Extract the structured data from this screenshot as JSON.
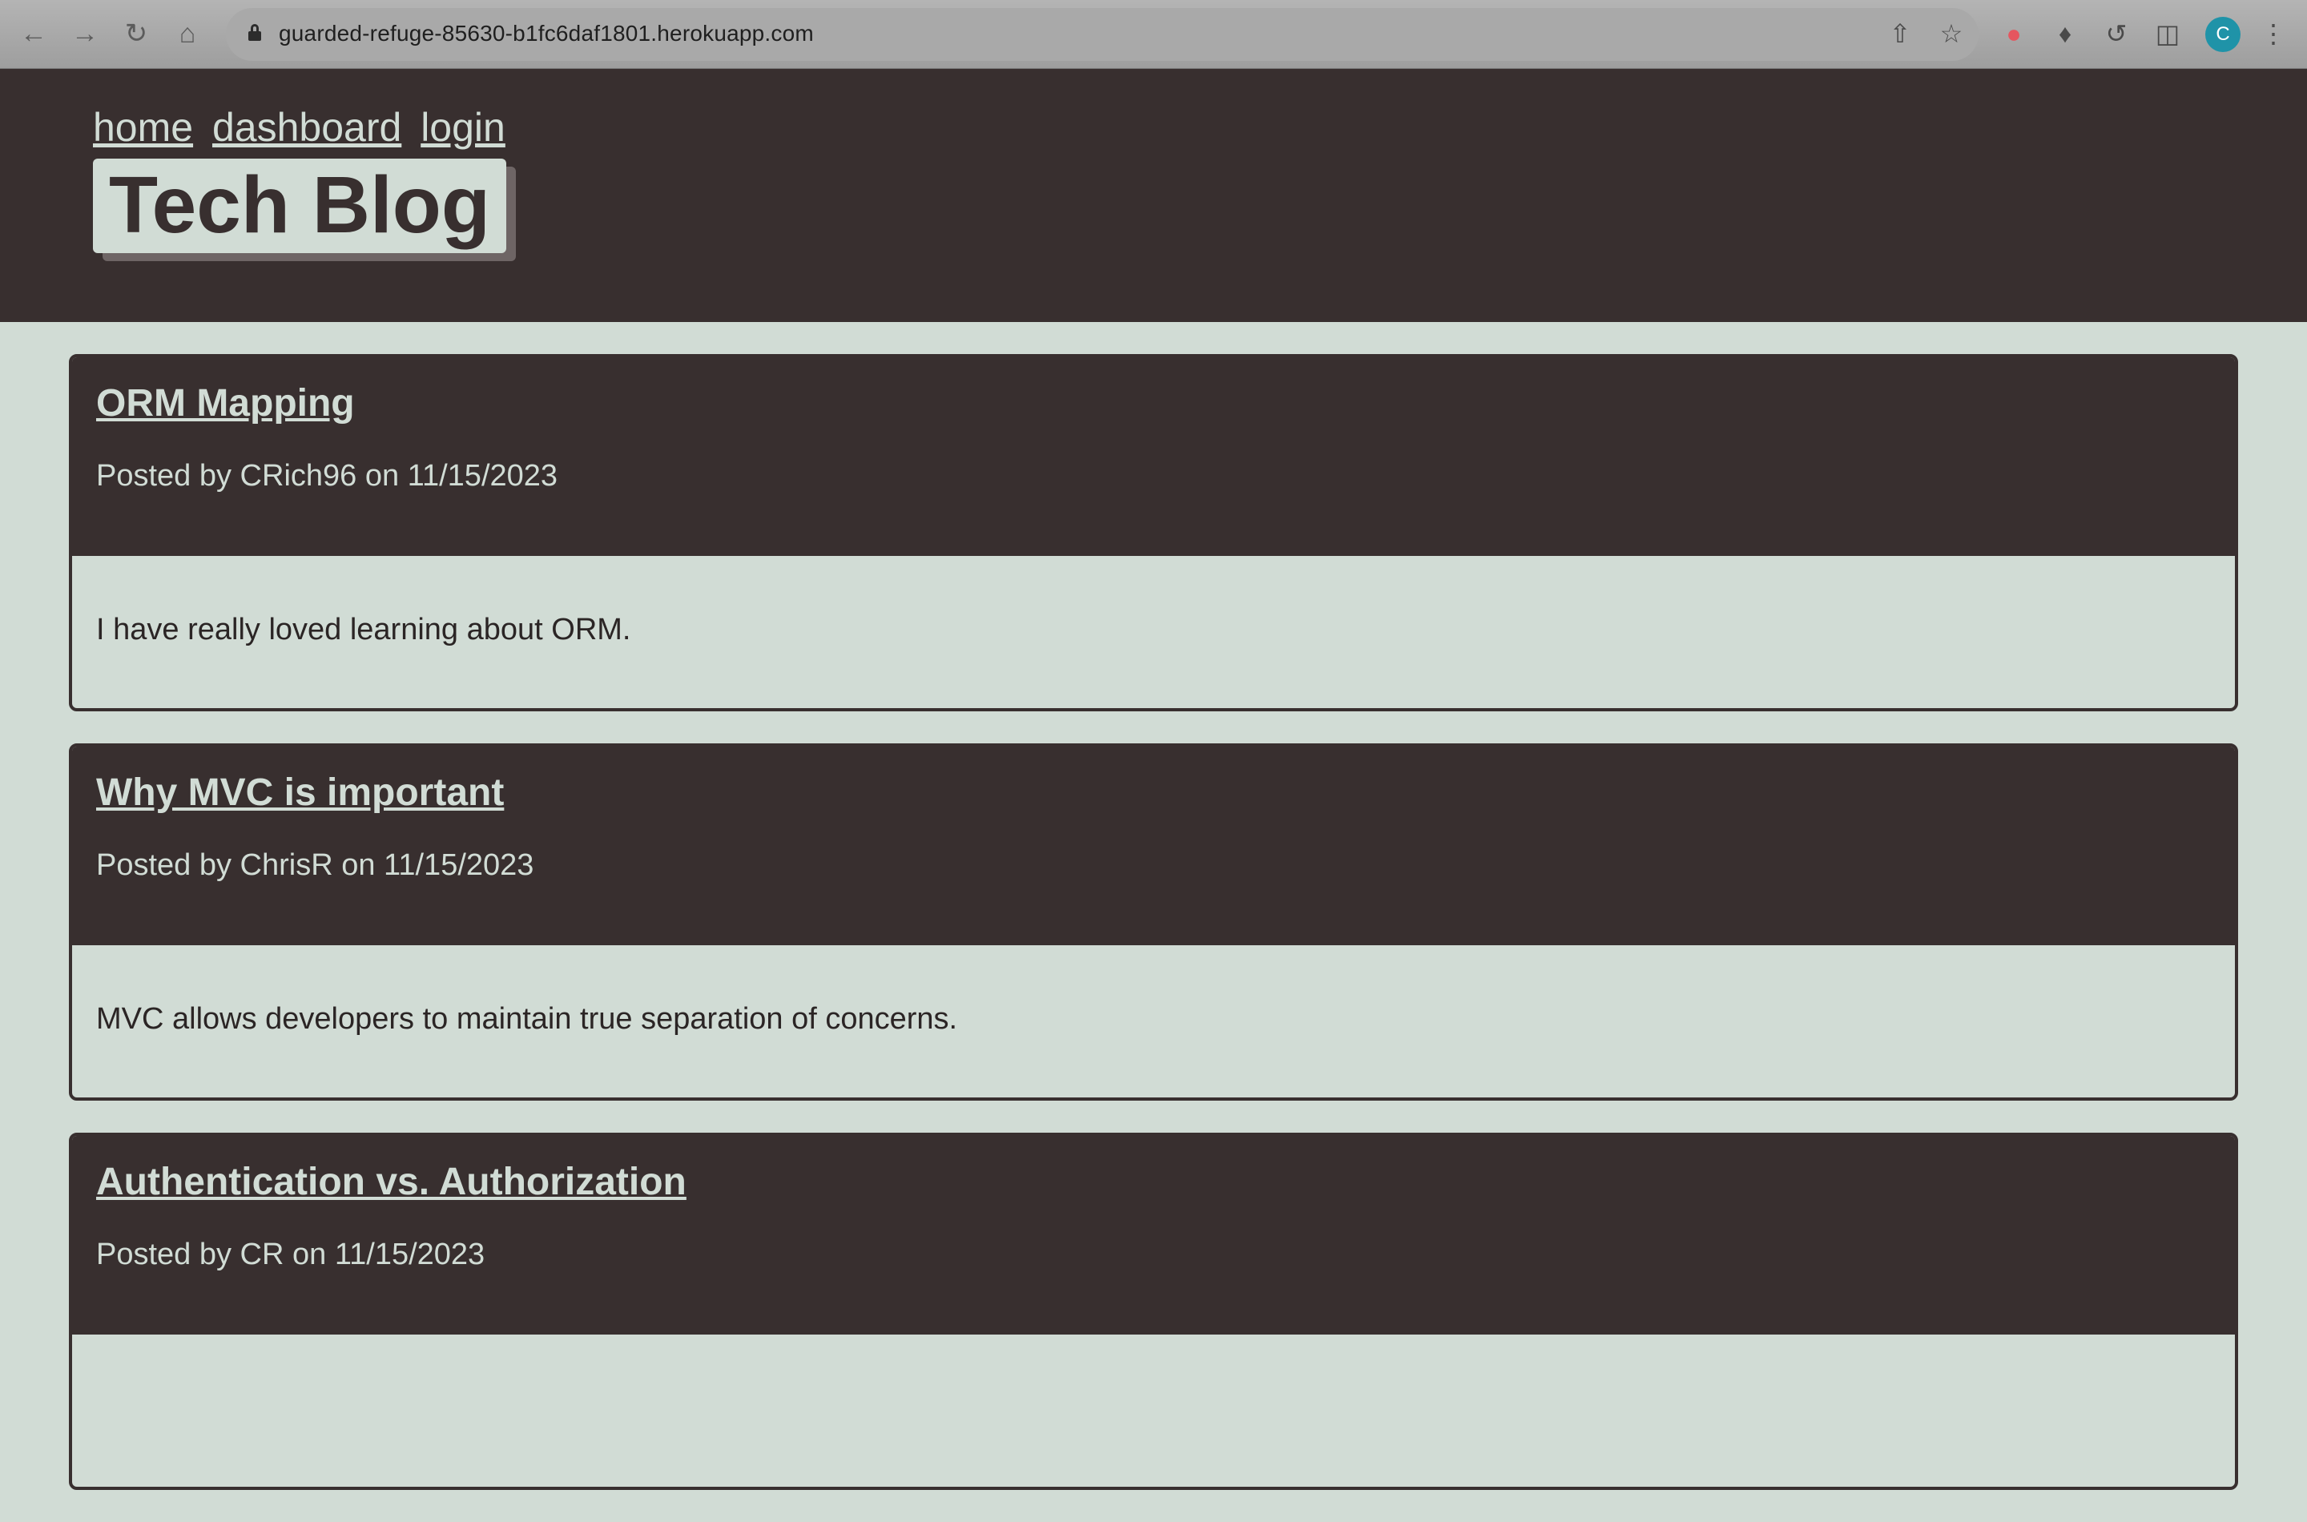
{
  "browser": {
    "url": "guarded-refuge-85630-b1fc6daf1801.herokuapp.com",
    "profile_initial": "C",
    "icons": [
      "back-icon",
      "forward-icon",
      "reload-icon",
      "home-icon",
      "lock-icon",
      "share-icon",
      "bookmark-star-icon",
      "extension-recorder-icon",
      "extensions-puzzle-icon",
      "extension-sync-icon",
      "side-panel-icon",
      "menu-kebab-icon"
    ]
  },
  "header": {
    "nav": [
      {
        "label": "home"
      },
      {
        "label": "dashboard"
      },
      {
        "label": "login"
      }
    ],
    "title": "Tech Blog"
  },
  "posts": [
    {
      "title": "ORM Mapping",
      "meta": "Posted by CRich96 on 11/15/2023",
      "body": "I have really loved learning about ORM."
    },
    {
      "title": "Why MVC is important",
      "meta": "Posted by ChrisR on 11/15/2023",
      "body": "MVC allows developers to maintain true separation of concerns."
    },
    {
      "title": "Authentication vs. Authorization",
      "meta": "Posted by CR on 11/15/2023",
      "body": ""
    }
  ],
  "colors": {
    "dark": "#382f2f",
    "light": "#d1dcd5"
  }
}
